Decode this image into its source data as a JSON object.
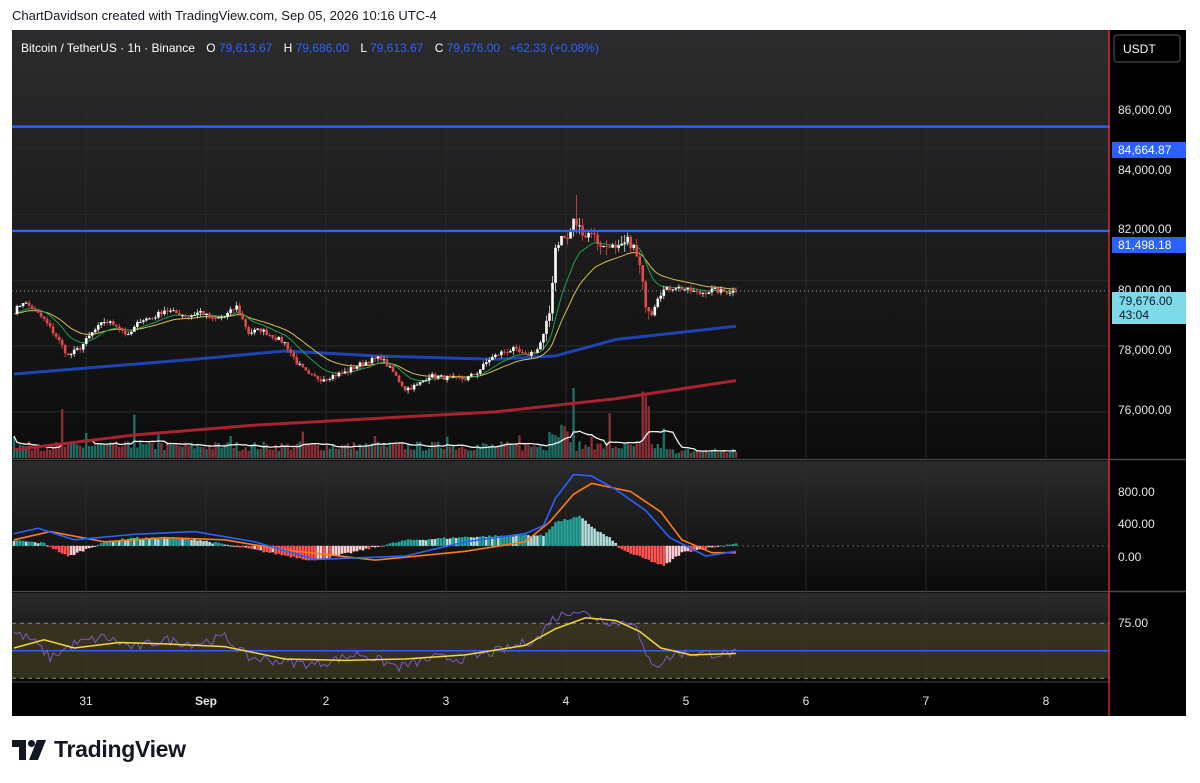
{
  "header": {
    "credit": "ChartDavidson created with TradingView.com, Sep 05, 2026 10:16 UTC-4"
  },
  "symbol_bar": {
    "symbol": "Bitcoin / TetherUS · 1h · Binance",
    "o_label": "O",
    "o_value": "79,613.67",
    "h_label": "H",
    "h_value": "79,686.00",
    "l_label": "L",
    "l_value": "79,613.67",
    "c_label": "C",
    "c_value": "79,676.00",
    "change": "+62.33 (+0.08%)"
  },
  "currency_button": "USDT",
  "price_axis": {
    "ticks": [
      "86,000.00",
      "84,000.00",
      "82,000.00",
      "80,000.00",
      "78,000.00",
      "76,000.00"
    ],
    "level_tags": [
      "84,664.87",
      "81,498.18"
    ],
    "last_price": "79,676.00",
    "countdown": "43:04"
  },
  "macd_axis": {
    "ticks": [
      "800.00",
      "400.00",
      "0.00"
    ]
  },
  "rsi_axis": {
    "ticks": [
      "75.00"
    ]
  },
  "time_axis": {
    "labels": [
      "31",
      "Sep",
      "2",
      "3",
      "4",
      "5",
      "6",
      "7",
      "8"
    ]
  },
  "brand": {
    "name": "TradingView"
  },
  "colors": {
    "background": "#000000",
    "up": "#ffffff",
    "down": "#e04a4a",
    "resistance": "#2962ff",
    "ema_fast": "#21a04a",
    "ema_mid": "#d2c24a",
    "ma_blue": "#1e44b4",
    "ma_red": "#a8232f",
    "macd": "#2962ff",
    "signal": "#ff7a1a",
    "rsi": "#7e57c2",
    "rsi_ma": "#f2d73a",
    "cursor": "#ff2a2a"
  },
  "chart_data": {
    "type": "candlestick",
    "symbol": "BTCUSDT",
    "interval": "1h",
    "exchange": "Binance",
    "ylim": [
      74600,
      87600
    ],
    "time_labels": [
      "31",
      "Sep",
      "2",
      "3",
      "4",
      "5",
      "6",
      "7",
      "8"
    ],
    "horizontal_levels": [
      84664.87,
      81498.18
    ],
    "last_price": 79676.0,
    "close_path": [
      [
        0,
        79050
      ],
      [
        3,
        79350
      ],
      [
        6,
        79150
      ],
      [
        10,
        78800
      ],
      [
        14,
        78300
      ],
      [
        18,
        77700
      ],
      [
        22,
        77950
      ],
      [
        26,
        78400
      ],
      [
        30,
        78750
      ],
      [
        34,
        78650
      ],
      [
        38,
        78300
      ],
      [
        42,
        78800
      ],
      [
        46,
        78850
      ],
      [
        50,
        79100
      ],
      [
        54,
        79000
      ],
      [
        58,
        78900
      ],
      [
        62,
        79050
      ],
      [
        66,
        78800
      ],
      [
        70,
        78900
      ],
      [
        74,
        79200
      ],
      [
        78,
        78400
      ],
      [
        82,
        78500
      ],
      [
        86,
        78300
      ],
      [
        90,
        78100
      ],
      [
        94,
        77500
      ],
      [
        98,
        77100
      ],
      [
        102,
        77000
      ],
      [
        106,
        77100
      ],
      [
        110,
        77200
      ],
      [
        114,
        77400
      ],
      [
        118,
        77550
      ],
      [
        122,
        77650
      ],
      [
        126,
        77200
      ],
      [
        130,
        76700
      ],
      [
        134,
        76800
      ],
      [
        138,
        77100
      ],
      [
        142,
        77050
      ],
      [
        146,
        77000
      ],
      [
        150,
        77000
      ],
      [
        154,
        77200
      ],
      [
        158,
        77600
      ],
      [
        162,
        77800
      ],
      [
        166,
        77900
      ],
      [
        170,
        77700
      ],
      [
        174,
        77900
      ],
      [
        176,
        78300
      ],
      [
        178,
        79000
      ],
      [
        180,
        81000
      ],
      [
        182,
        81300
      ],
      [
        184,
        81250
      ],
      [
        186,
        81800
      ],
      [
        188,
        81600
      ],
      [
        190,
        81350
      ],
      [
        192,
        81500
      ],
      [
        194,
        81150
      ],
      [
        196,
        81000
      ],
      [
        198,
        81100
      ],
      [
        200,
        80900
      ],
      [
        202,
        81000
      ],
      [
        204,
        81200
      ],
      [
        206,
        81000
      ],
      [
        208,
        80400
      ],
      [
        210,
        79300
      ],
      [
        212,
        79000
      ],
      [
        214,
        79500
      ],
      [
        216,
        79700
      ],
      [
        220,
        79800
      ],
      [
        224,
        79700
      ],
      [
        228,
        79600
      ],
      [
        232,
        79700
      ],
      [
        236,
        79650
      ],
      [
        240,
        79676
      ]
    ],
    "ma_blue": [
      [
        0,
        77150
      ],
      [
        60,
        77600
      ],
      [
        90,
        77850
      ],
      [
        120,
        77700
      ],
      [
        160,
        77600
      ],
      [
        180,
        77700
      ],
      [
        200,
        78200
      ],
      [
        240,
        78600
      ]
    ],
    "ma_red": [
      [
        0,
        74850
      ],
      [
        40,
        75300
      ],
      [
        80,
        75600
      ],
      [
        120,
        75800
      ],
      [
        160,
        76000
      ],
      [
        200,
        76400
      ],
      [
        240,
        76950
      ]
    ],
    "macd_ylim": [
      -650,
      1250
    ],
    "macd": [
      [
        0,
        180
      ],
      [
        8,
        260
      ],
      [
        20,
        90
      ],
      [
        40,
        170
      ],
      [
        60,
        210
      ],
      [
        80,
        60
      ],
      [
        100,
        -200
      ],
      [
        130,
        -150
      ],
      [
        150,
        60
      ],
      [
        170,
        180
      ],
      [
        176,
        300
      ],
      [
        180,
        700
      ],
      [
        186,
        1050
      ],
      [
        192,
        1030
      ],
      [
        200,
        830
      ],
      [
        210,
        520
      ],
      [
        218,
        120
      ],
      [
        230,
        -150
      ],
      [
        240,
        -80
      ]
    ],
    "signal": [
      [
        0,
        90
      ],
      [
        12,
        210
      ],
      [
        30,
        60
      ],
      [
        50,
        120
      ],
      [
        70,
        90
      ],
      [
        90,
        -60
      ],
      [
        120,
        -210
      ],
      [
        150,
        -80
      ],
      [
        170,
        60
      ],
      [
        178,
        350
      ],
      [
        186,
        760
      ],
      [
        192,
        920
      ],
      [
        205,
        800
      ],
      [
        215,
        500
      ],
      [
        222,
        90
      ],
      [
        232,
        -100
      ],
      [
        240,
        -100
      ]
    ],
    "macd_hist": [
      [
        0,
        80
      ],
      [
        10,
        40
      ],
      [
        18,
        -160
      ],
      [
        30,
        60
      ],
      [
        40,
        120
      ],
      [
        60,
        100
      ],
      [
        80,
        -60
      ],
      [
        100,
        -220
      ],
      [
        130,
        80
      ],
      [
        150,
        130
      ],
      [
        170,
        160
      ],
      [
        176,
        150
      ],
      [
        180,
        350
      ],
      [
        188,
        430
      ],
      [
        194,
        220
      ],
      [
        198,
        120
      ],
      [
        202,
        -60
      ],
      [
        212,
        -230
      ],
      [
        216,
        -300
      ],
      [
        222,
        -100
      ],
      [
        240,
        40
      ]
    ],
    "rsi_ylim": [
      28,
      92
    ],
    "rsi_bands": [
      70,
      30
    ],
    "rsi": [
      [
        0,
        63
      ],
      [
        6,
        58
      ],
      [
        12,
        45
      ],
      [
        20,
        55
      ],
      [
        30,
        60
      ],
      [
        40,
        52
      ],
      [
        50,
        58
      ],
      [
        60,
        55
      ],
      [
        70,
        60
      ],
      [
        78,
        45
      ],
      [
        90,
        42
      ],
      [
        100,
        40
      ],
      [
        115,
        48
      ],
      [
        128,
        38
      ],
      [
        140,
        45
      ],
      [
        150,
        44
      ],
      [
        165,
        52
      ],
      [
        175,
        60
      ],
      [
        178,
        72
      ],
      [
        186,
        80
      ],
      [
        192,
        75
      ],
      [
        200,
        70
      ],
      [
        206,
        72
      ],
      [
        210,
        45
      ],
      [
        214,
        40
      ],
      [
        220,
        48
      ],
      [
        240,
        48
      ]
    ],
    "rsi_ma": [
      [
        0,
        52
      ],
      [
        10,
        58
      ],
      [
        20,
        52
      ],
      [
        35,
        56
      ],
      [
        50,
        55
      ],
      [
        70,
        53
      ],
      [
        90,
        44
      ],
      [
        110,
        43
      ],
      [
        130,
        44
      ],
      [
        150,
        47
      ],
      [
        170,
        54
      ],
      [
        180,
        66
      ],
      [
        190,
        74
      ],
      [
        200,
        72
      ],
      [
        208,
        64
      ],
      [
        215,
        52
      ],
      [
        225,
        47
      ],
      [
        240,
        48
      ]
    ],
    "volume_max": 100
  }
}
